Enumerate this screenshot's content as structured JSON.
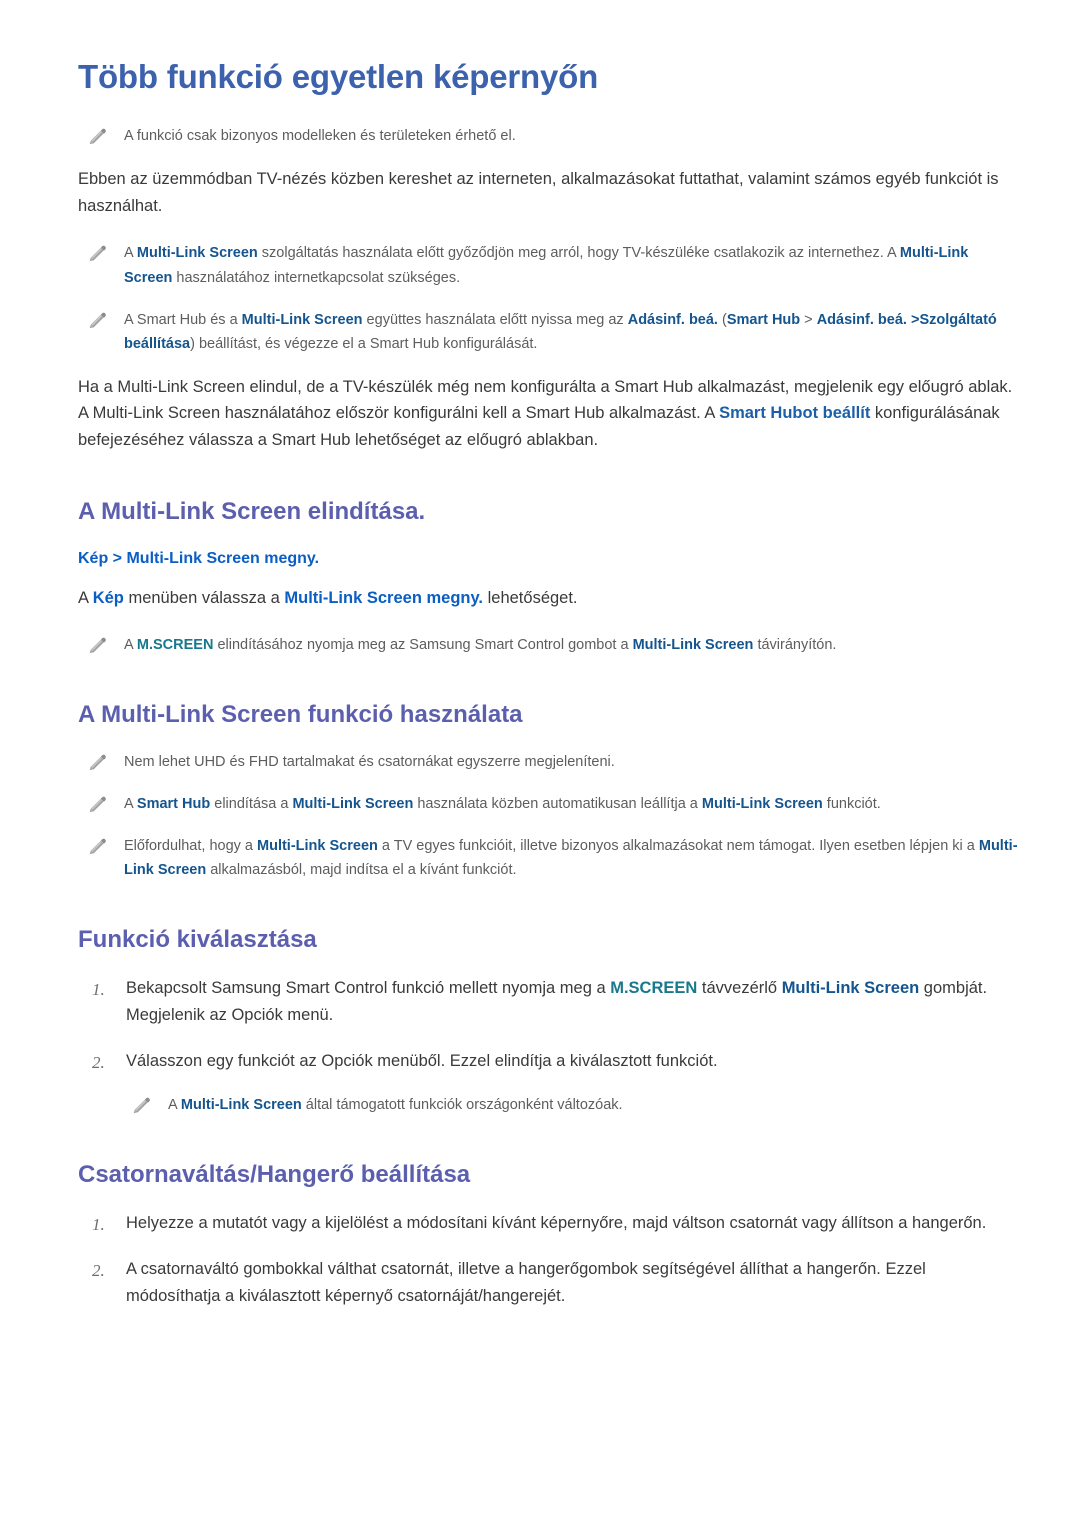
{
  "page": {
    "title": "Több funkció egyetlen képernyőn",
    "icons": {
      "note": "pencil-icon"
    },
    "colors": {
      "title_blue": "#3c62ae",
      "heading_purple": "#5b5fae",
      "term_navy": "#15558f",
      "term_blue": "#0a5ec4",
      "term_teal": "#18798c",
      "body_gray": "#3a3a3a",
      "note_gray": "#5d5d5d",
      "page_bg": "#ffffff"
    }
  },
  "intro": {
    "note_1": "A funkció csak bizonyos modelleken és területeken érhető el.",
    "paragraph_1": "Ebben az üzemmódban TV-nézés közben kereshet az interneten, alkalmazásokat futtathat, valamint számos egyéb funkciót is használhat.",
    "note_2": {
      "t1": "A ",
      "term1": "Multi-Link Screen",
      "t2": " szolgáltatás használata előtt győződjön meg arról, hogy TV-készüléke csatlakozik az internethez. A ",
      "term2": "Multi-Link Screen",
      "t3": " használatához internetkapcsolat szükséges."
    },
    "note_3": {
      "t1": "A Smart Hub és a ",
      "term1": "Multi-Link Screen",
      "t2": " együttes használata előtt nyissa meg az ",
      "term2": "Adásinf. beá.",
      "t3": " (",
      "term3": "Smart Hub",
      "t4": " > ",
      "term4": "Adásinf. beá. >",
      "term5": "Szolgáltató beállítása",
      "t5": ") beállítást, és végezze el a Smart Hub konfigurálását."
    },
    "paragraph_2": {
      "t1": "Ha a Multi-Link Screen elindul, de a TV-készülék még nem konfigurálta a Smart Hub alkalmazást, megjelenik egy előugró ablak. A Multi-Link Screen használatához először konfigurálni kell a Smart Hub alkalmazást. A ",
      "term1": "Smart Hubot beállít",
      "t2": " konfigurálásának befejezéséhez válassza a Smart Hub lehetőséget az előugró ablakban."
    }
  },
  "section_start": {
    "heading": "A Multi-Link Screen elindítása.",
    "menu_path": "Kép > Multi-Link Screen megny.",
    "instruction": {
      "t1": "A ",
      "term1": "Kép",
      "t2": " menüben válassza a ",
      "term2": "Multi-Link Screen megny.",
      "t3": " lehetőséget."
    },
    "note": {
      "t1": "A ",
      "term1": "M.SCREEN",
      "t2": " elindításához nyomja meg az Samsung Smart Control gombot a ",
      "term2": "Multi-Link Screen",
      "t3": " távirányítón."
    }
  },
  "section_usage": {
    "heading": "A Multi-Link Screen funkció használata",
    "note_1": "Nem lehet UHD és FHD tartalmakat és csatornákat egyszerre megjeleníteni.",
    "note_2": {
      "t1": "A ",
      "term1": "Smart Hub",
      "t2": " elindítása a ",
      "term2": "Multi-Link Screen",
      "t3": " használata közben automatikusan leállítja a ",
      "term3": "Multi-Link Screen",
      "t4": " funkciót."
    },
    "note_3": {
      "t1": "Előfordulhat, hogy a ",
      "term1": "Multi-Link Screen",
      "t2": " a TV egyes funkcióit, illetve bizonyos alkalmazásokat nem támogat. Ilyen esetben lépjen ki a ",
      "term2": "Multi-Link Screen",
      "t3": " alkalmazásból, majd indítsa el a kívánt funkciót."
    }
  },
  "section_function": {
    "heading": "Funkció kiválasztása",
    "steps": [
      {
        "number": "1.",
        "t1": "Bekapcsolt Samsung Smart Control funkció mellett nyomja meg a ",
        "term1": "M.SCREEN",
        "t2": " távvezérlő ",
        "term2": "Multi-Link Screen",
        "t3": " gombját. Megjelenik az Opciók menü."
      },
      {
        "number": "2.",
        "t1": "Válasszon egy funkciót az Opciók menüből. Ezzel elindítja a kiválasztott funkciót.",
        "term1": "",
        "t2": "",
        "term2": "",
        "t3": ""
      }
    ],
    "note": {
      "t1": "A ",
      "term1": "Multi-Link Screen",
      "t2": " által támogatott funkciók országonként változóak."
    }
  },
  "section_channel": {
    "heading": "Csatornaváltás/Hangerő beállítása",
    "steps": [
      {
        "number": "1.",
        "text": "Helyezze a mutatót vagy a kijelölést a módosítani kívánt képernyőre, majd váltson csatornát vagy állítson a hangerőn."
      },
      {
        "number": "2.",
        "text": "A csatornaváltó gombokkal válthat csatornát, illetve a hangerőgombok segítségével állíthat a hangerőn. Ezzel módosíthatja a kiválasztott képernyő csatornáját/hangerejét."
      }
    ]
  }
}
